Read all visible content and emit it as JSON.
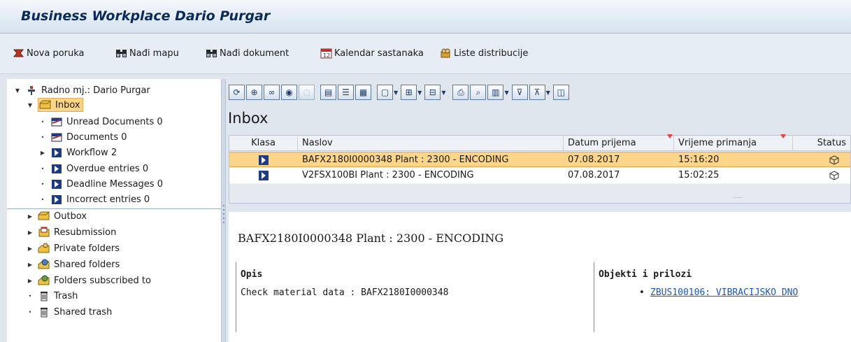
{
  "window": {
    "title": "Business Workplace  Dario Purgar"
  },
  "appbar": {
    "buttons": [
      {
        "label": "Nova poruka",
        "icon": "new-message-icon"
      },
      {
        "label": "Nađi mapu",
        "icon": "binoculars-icon"
      },
      {
        "label": "Nađi dokument",
        "icon": "binoculars-icon"
      },
      {
        "label": "Kalendar sastanaka",
        "icon": "calendar-icon"
      },
      {
        "label": "Liste distribucije",
        "icon": "distribution-list-icon"
      }
    ]
  },
  "tree": {
    "root": "Radno mj.: Dario Purgar",
    "inbox": "Inbox",
    "inbox_children": [
      "Unread Documents 0",
      "Documents 0",
      "Workflow 2",
      "Overdue entries 0",
      "Deadline Messages 0",
      "Incorrect entries 0"
    ],
    "folders": [
      "Outbox",
      "Resubmission",
      "Private folders",
      "Shared folders",
      "Folders subscribed to",
      "Trash",
      "Shared trash"
    ]
  },
  "main": {
    "title": "Inbox",
    "columns": [
      "Klasa",
      "Naslov",
      "Datum prijema",
      "Vrijeme primanja",
      "Status"
    ],
    "rows": [
      {
        "naslov": "BAFX2180I0000348 Plant : 2300 - ENCODING",
        "datum": "07.08.2017",
        "vrijeme": "15:16:20",
        "selected": true
      },
      {
        "naslov": "V2FSX100BI Plant : 2300 - ENCODING",
        "datum": "07.08.2017",
        "vrijeme": "15:02:25",
        "selected": false
      }
    ],
    "splitter_dots": "....."
  },
  "preview": {
    "title": "BAFX2180I0000348 Plant  : 2300 - ENCODING",
    "opis_label": "Opis",
    "opis_text": "Check material data : BAFX2180I0000348",
    "objects_label": "Objekti i prilozi",
    "objects_link": "ZBUS100106: VIBRACIJSKO DNO"
  },
  "colors": {
    "selection": "#fbd58a",
    "title": "#0a2a5a",
    "link": "#1a56c8"
  }
}
